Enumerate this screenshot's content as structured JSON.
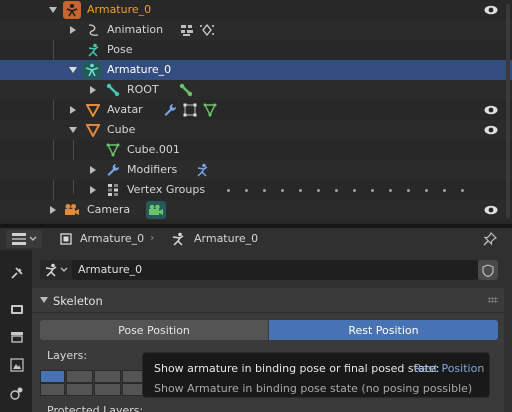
{
  "outliner": {
    "rows": [
      {
        "label": "Armature_0"
      },
      {
        "label": "Animation"
      },
      {
        "label": "Pose"
      },
      {
        "label": "Armature_0"
      },
      {
        "label": "ROOT"
      },
      {
        "label": "Avatar"
      },
      {
        "label": "Cube"
      },
      {
        "label": "Cube.001"
      },
      {
        "label": "Modifiers"
      },
      {
        "label": "Vertex Groups"
      },
      {
        "label": "Camera"
      }
    ]
  },
  "header": {
    "object_name": "Armature_0",
    "data_name": "Armature_0"
  },
  "datablock": {
    "name": "Armature_0"
  },
  "skeleton": {
    "title": "Skeleton",
    "pose_position_label": "Pose Position",
    "rest_position_label": "Rest Position",
    "selected": "Rest Position",
    "layers_label": "Layers:",
    "protected_layers_label": "Protected Layers:"
  },
  "tooltip": {
    "line1": "Show armature in binding pose or final posed state:",
    "line1_value": "Rest Position",
    "line2": "Show Armature in binding pose state (no posing possible)"
  },
  "colors": {
    "selected_row": "#334d80",
    "active_button": "#4772b3",
    "armature_icon": "#45c8b3",
    "mesh_icon": "#e28a3b",
    "data_icon": "#6bc46b",
    "highlight_text": "#f0a020",
    "modifier_icon": "#5e8ed6"
  },
  "icons": {
    "armature": "armature-icon",
    "action": "action-icon",
    "pose": "pose-icon",
    "bone": "bone-icon",
    "mesh": "mesh-triangle-icon",
    "wrench": "wrench-icon",
    "vertex_groups": "vertex-groups-icon",
    "camera": "camera-icon",
    "eye": "eye-icon"
  }
}
